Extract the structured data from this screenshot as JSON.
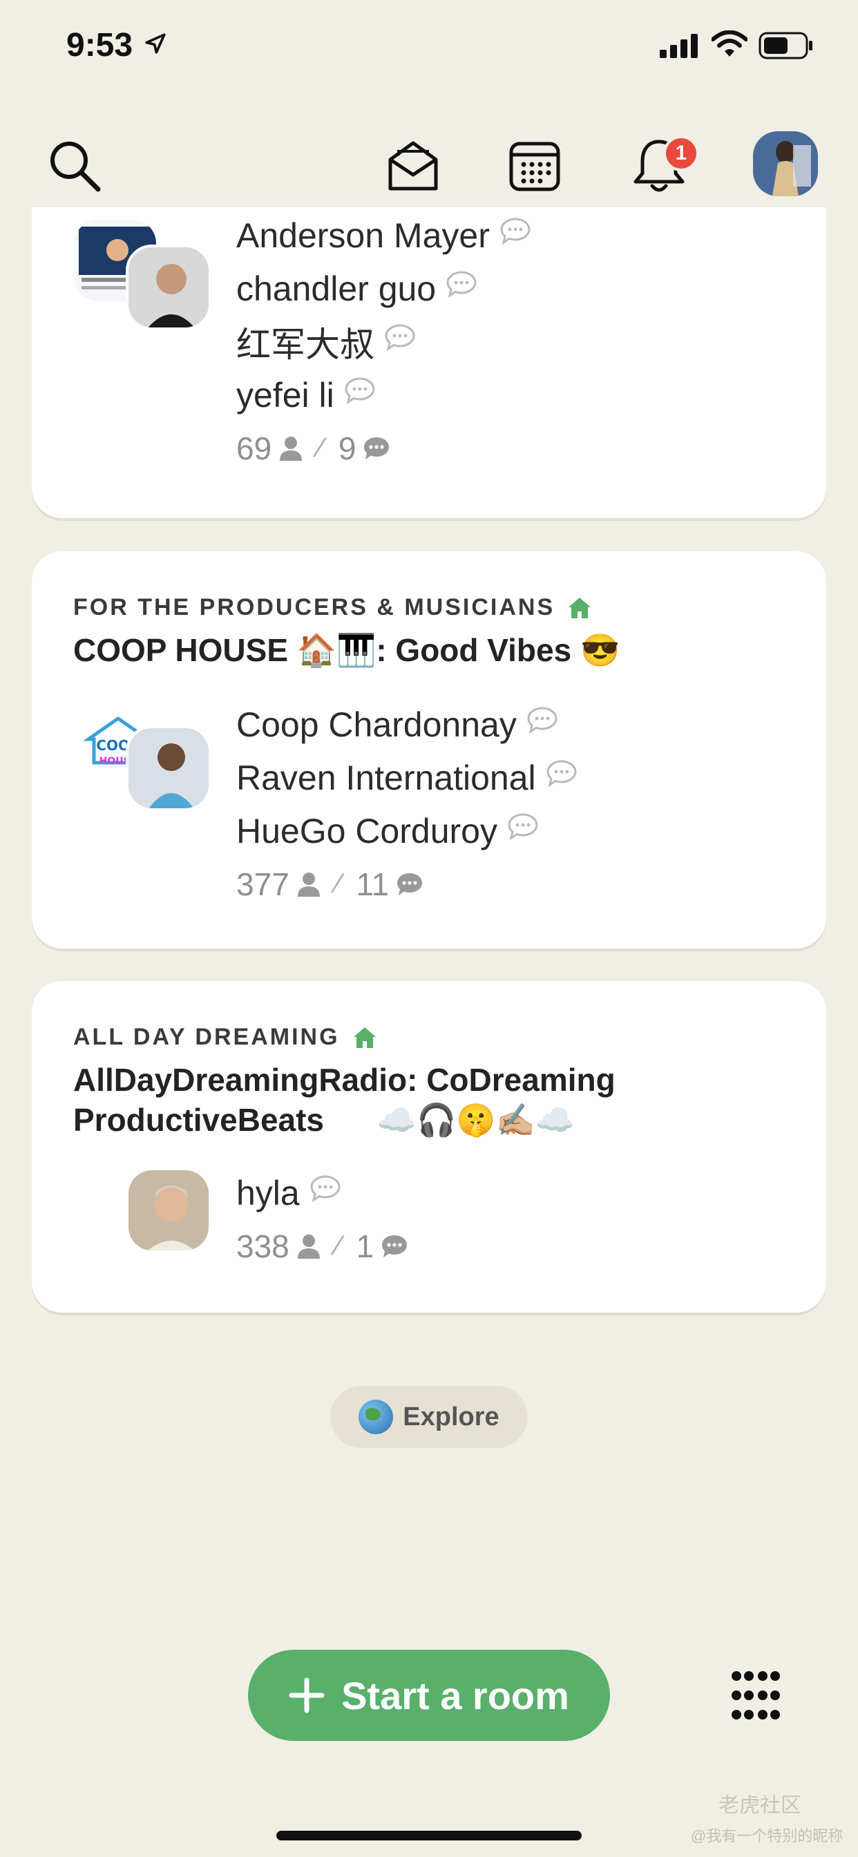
{
  "status_bar": {
    "time": "9:53"
  },
  "topnav": {
    "notification_count": "1"
  },
  "rooms": [
    {
      "speakers": [
        "Anderson Mayer",
        "chandler guo",
        "红军大叔",
        "yefei li"
      ],
      "listeners": "69",
      "speaker_count": "9"
    },
    {
      "club": "FOR THE PRODUCERS & MUSICIANS",
      "title": "COOP HOUSE 🏠🎹: Good Vibes 😎",
      "speakers": [
        "Coop Chardonnay",
        "Raven International",
        "HueGo Corduroy"
      ],
      "listeners": "377",
      "speaker_count": "11"
    },
    {
      "club": "ALL DAY DREAMING",
      "title_line1": "AllDayDreamingRadio: CoDreaming",
      "title_line2": "ProductiveBeats      ☁️🎧🤫✍🏼☁️",
      "speakers": [
        "hyla"
      ],
      "listeners": "338",
      "speaker_count": "1"
    }
  ],
  "explore": {
    "label": "Explore"
  },
  "start_room": {
    "label": "Start a room"
  },
  "watermark": {
    "brand": "老虎社区",
    "handle": "@我有一个特别的昵称"
  },
  "colors": {
    "background": "#f1efe5",
    "accent_green": "#58b06a",
    "badge_red": "#e84a3c"
  }
}
